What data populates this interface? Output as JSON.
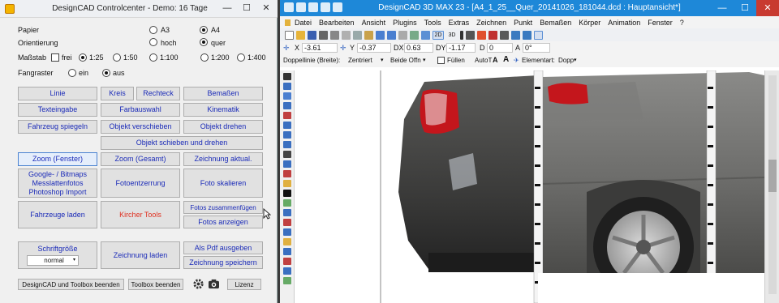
{
  "cc": {
    "title": "DesignCAD Controlcenter - Demo: 16 Tage",
    "papier_label": "Papier",
    "papier_a3": "A3",
    "papier_a4": "A4",
    "orient_label": "Orientierung",
    "orient_hoch": "hoch",
    "orient_quer": "quer",
    "massstab_label": "Maßstab",
    "massstab_frei": "frei",
    "scales": [
      "1:25",
      "1:50",
      "1:100",
      "1:200",
      "1:400"
    ],
    "fangraster_label": "Fangraster",
    "fang_ein": "ein",
    "fang_aus": "aus",
    "buttons": {
      "linie": "Linie",
      "kreis": "Kreis",
      "rechteck": "Rechteck",
      "bemassen": "Bemaßen",
      "texteingabe": "Texteingabe",
      "farbauswahl": "Farbauswahl",
      "kinematik": "Kinematik",
      "fahrzeug_spiegeln": "Fahrzeug spiegeln",
      "objekt_verschieben": "Objekt verschieben",
      "objekt_drehen": "Objekt drehen",
      "objekt_schieben_drehen": "Objekt schieben und drehen",
      "zoom_fenster": "Zoom (Fenster)",
      "zoom_gesamt": "Zoom (Gesamt)",
      "zeichnung_aktual": "Zeichnung aktual.",
      "google_l1": "Google- / Bitmaps",
      "google_l2": "Messlattenfotos",
      "google_l3": "Photoshop Import",
      "fotoentzerrung": "Fotoentzerrung",
      "foto_skalieren": "Foto skalieren",
      "fotos_zusammenfuegen": "Fotos zusammenfügen",
      "fotos_anzeigen": "Fotos anzeigen",
      "fahrzeuge_laden": "Fahrzeuge laden",
      "kircher_tools": "Kircher Tools",
      "schriftgroesse": "Schriftgröße",
      "schrift_value": "normal",
      "zeichnung_laden": "Zeichnung laden",
      "als_pdf": "Als Pdf ausgeben",
      "zeichnung_speichern": "Zeichnung speichern",
      "designcad_toolbox_beenden": "DesignCAD und Toolbox  beenden",
      "toolbox_beenden": "Toolbox beenden",
      "lizenz": "Lizenz"
    }
  },
  "dc": {
    "title": "DesignCAD 3D MAX 23 - [A4_1_25__Quer_20141026_181044.dcd : Hauptansicht*]",
    "menu": [
      "Datei",
      "Bearbeiten",
      "Ansicht",
      "Plugins",
      "Tools",
      "Extras",
      "Zeichnen",
      "Punkt",
      "Bemaßen",
      "Körper",
      "Animation",
      "Fenster",
      "?"
    ],
    "coords": {
      "x_label": "X",
      "x": "-3.61",
      "y_label": "Y",
      "y": "-0.37",
      "dx_label": "DX",
      "dx": "0.63",
      "dy_label": "DY",
      "dy": "-1.17",
      "d_label": "D",
      "d": "0",
      "a_label": "A",
      "a": "0°"
    },
    "tb2": {
      "doppellinie_label": "Doppellinie (Breite):",
      "doppellinie_value": "Zentriert",
      "beide_value": "Beide Offn",
      "fuellen": "Füllen",
      "autotext": "AutoT",
      "elementart_label": "Elementart:",
      "elementart_value": "Dopp"
    }
  },
  "colors": {
    "link_blue": "#1b2bb8",
    "red_button": "#e03020",
    "title_blue": "#1e88d8"
  }
}
